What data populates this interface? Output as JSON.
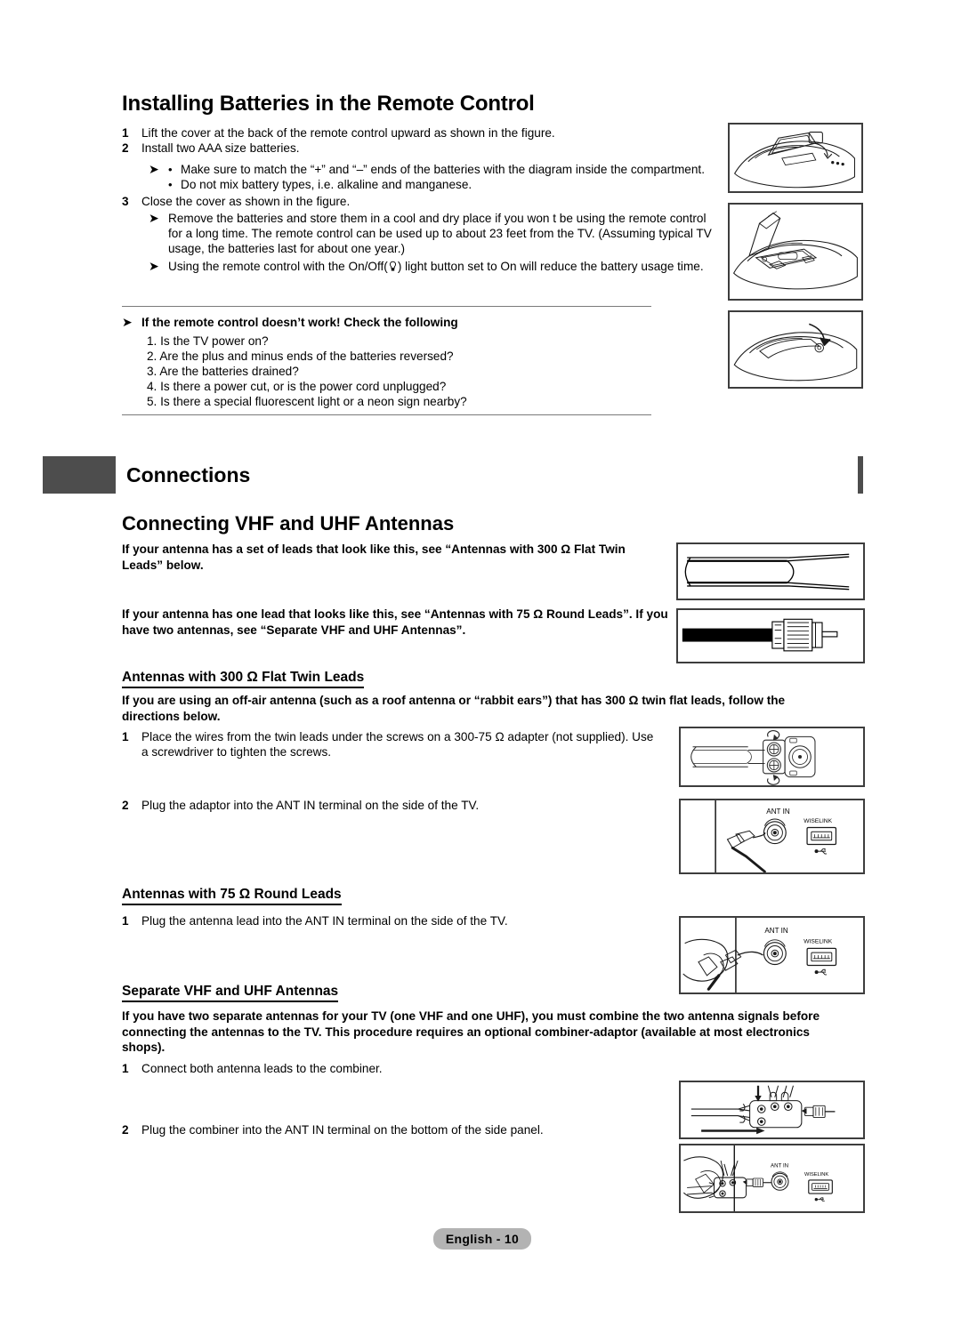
{
  "document": {
    "footer_label": "English - 10",
    "accent_banner_color": "#4d4d4d",
    "footer_pill_color": "#b3b3b3"
  },
  "section_remote": {
    "title": "Installing Batteries in the Remote Control",
    "steps": [
      {
        "num": "1",
        "text": "Lift the cover at the back of the remote control upward as shown in the figure."
      },
      {
        "num": "2",
        "text": "Install two AAA size batteries."
      }
    ],
    "bullets": [
      "Make sure to match the “+” and “–” ends of the batteries with the diagram inside the compartment.",
      "Do not mix battery types, i.e. alkaline and manganese."
    ],
    "step3": {
      "num": "3",
      "text": "Close the cover as shown in the figure."
    },
    "notes": [
      "Remove the batteries and store them in a cool and dry place if you won t be using the remote control for a long time. The remote control can be used up to about 23 feet from the TV. (Assuming typical TV usage, the batteries last for about one year.)",
      "Using the remote control with the On/Off(☀) light button set to On will reduce the battery usage time."
    ],
    "note2_prefix": "Using the remote control with the On/Off(",
    "note2_suffix": ") light button set to On will reduce the battery usage time.",
    "troubleshoot_title": "If the remote control doesn’t work! Check the following",
    "troubleshoot_items": [
      "1. Is the TV power on?",
      "2. Are the plus and minus ends of the batteries reversed?",
      "3. Are the batteries drained?",
      "4. Is there a power cut, or is the power cord unplugged?",
      "5. Is there a special fluorescent light or a neon sign nearby?"
    ]
  },
  "section_connections": {
    "banner_title": "Connections",
    "subtitle": "Connecting VHF and UHF Antennas",
    "intro_1": "If your antenna has a set of leads that look like this, see “Antennas with 300 Ω Flat Twin Leads” below.",
    "intro_2": "If your antenna has one lead that looks like this, see “Antennas with 75 Ω Round Leads”. If you have two antennas, see “Separate VHF and UHF Antennas”.",
    "flat_twin": {
      "heading": "Antennas with 300 Ω Flat Twin Leads",
      "intro": "If you are using an off-air antenna (such as a roof antenna or “rabbit ears”) that has 300 Ω twin flat leads, follow the directions below.",
      "steps": [
        {
          "num": "1",
          "text": "Place the wires from the twin leads under the screws on a 300-75 Ω adapter (not supplied). Use a screwdriver to tighten the screws."
        },
        {
          "num": "2",
          "text": "Plug the adaptor into the ANT IN terminal on the side of the TV."
        }
      ]
    },
    "round_leads": {
      "heading": "Antennas with 75 Ω Round Leads",
      "steps": [
        {
          "num": "1",
          "text": "Plug the antenna lead into the ANT IN terminal on the side of the TV."
        }
      ]
    },
    "separate": {
      "heading": "Separate VHF and UHF Antennas",
      "intro": "If you have two separate antennas for your TV (one VHF and one UHF), you must combine the two antenna signals before connecting the antennas to the TV. This procedure requires an optional combiner-adaptor (available at most electronics shops).",
      "steps": [
        {
          "num": "1",
          "text": "Connect both antenna leads to the combiner."
        },
        {
          "num": "2",
          "text": "Plug the combiner into the ANT IN terminal on the bottom of the side panel."
        }
      ]
    }
  },
  "figures": {
    "remote_open_cover": {
      "name": "remote-cover-lift-figure"
    },
    "remote_batteries": {
      "name": "remote-batteries-figure"
    },
    "remote_close_cover": {
      "name": "remote-cover-close-figure"
    },
    "flat_twin_lead": {
      "name": "flat-twin-lead-figure"
    },
    "coax_lead": {
      "name": "coaxial-round-lead-figure"
    },
    "adapter_screws": {
      "name": "adapter-screws-figure"
    },
    "ant_in_side_panel": {
      "name": "ant-in-panel-figure",
      "ant_label": "ANT IN",
      "wiselink_label": "WISELINK"
    },
    "ant_in_hand": {
      "name": "ant-in-hand-figure",
      "ant_label": "ANT IN",
      "wiselink_label": "WISELINK"
    },
    "combiner": {
      "name": "combiner-figure"
    },
    "combiner_panel": {
      "name": "combiner-panel-figure",
      "ant_label": "ANT IN",
      "wiselink_label": "WISELINK"
    }
  }
}
